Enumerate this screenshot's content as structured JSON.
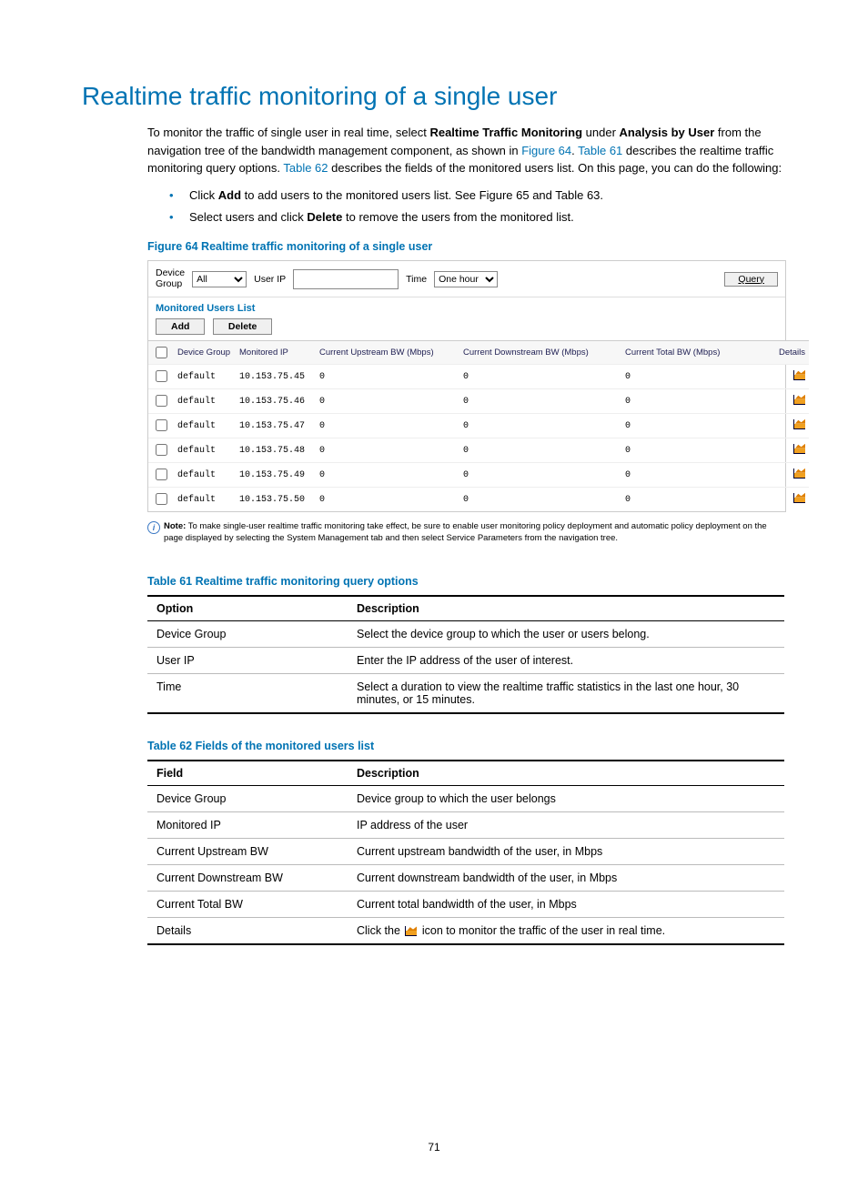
{
  "title": "Realtime traffic monitoring of a single user",
  "intro_parts": [
    {
      "t": "To monitor the traffic of single user in real time, select "
    },
    {
      "t": "Realtime Traffic Monitoring",
      "b": true
    },
    {
      "t": " under "
    },
    {
      "t": "Analysis by User",
      "b": true
    },
    {
      "t": " from the navigation tree of the bandwidth management component, as shown in "
    },
    {
      "t": "Figure 64",
      "link": true
    },
    {
      "t": ". "
    },
    {
      "t": "Table 61",
      "link": true
    },
    {
      "t": " describes the realtime traffic monitoring query options. "
    },
    {
      "t": "Table 62",
      "link": true
    },
    {
      "t": " describes the fields of the monitored users list. On this page, you can do the following:"
    }
  ],
  "bullets": [
    [
      {
        "t": "Click "
      },
      {
        "t": "Add",
        "b": true
      },
      {
        "t": " to add users to the monitored users list. See "
      },
      {
        "t": "Figure 65",
        "link": true
      },
      {
        "t": " and "
      },
      {
        "t": "Table 63",
        "link": true
      },
      {
        "t": "."
      }
    ],
    [
      {
        "t": "Select users and click "
      },
      {
        "t": "Delete",
        "b": true
      },
      {
        "t": " to remove the users from the monitored list."
      }
    ]
  ],
  "figure64_caption": "Figure 64  Realtime traffic monitoring of a single user",
  "ui": {
    "device_group_label": "Device\nGroup",
    "device_group_value": "All",
    "user_ip_label": "User IP",
    "user_ip_value": "",
    "time_label": "Time",
    "time_value": "One hour",
    "query_label": "Query",
    "section_title": "Monitored Users List",
    "add_label": "Add",
    "delete_label": "Delete",
    "headers": {
      "dg": "Device Group",
      "ip": "Monitored IP",
      "up": "Current Upstream BW (Mbps)",
      "dn": "Current Downstream BW (Mbps)",
      "tot": "Current Total BW (Mbps)",
      "det": "Details"
    },
    "rows": [
      {
        "dg": "default",
        "ip": "10.153.75.45",
        "up": "0",
        "dn": "0",
        "tot": "0"
      },
      {
        "dg": "default",
        "ip": "10.153.75.46",
        "up": "0",
        "dn": "0",
        "tot": "0"
      },
      {
        "dg": "default",
        "ip": "10.153.75.47",
        "up": "0",
        "dn": "0",
        "tot": "0"
      },
      {
        "dg": "default",
        "ip": "10.153.75.48",
        "up": "0",
        "dn": "0",
        "tot": "0"
      },
      {
        "dg": "default",
        "ip": "10.153.75.49",
        "up": "0",
        "dn": "0",
        "tot": "0"
      },
      {
        "dg": "default",
        "ip": "10.153.75.50",
        "up": "0",
        "dn": "0",
        "tot": "0"
      }
    ]
  },
  "note_label": "Note:",
  "note_text": "To make single-user realtime traffic monitoring take effect, be sure to enable user monitoring policy deployment and automatic policy deployment on the page displayed by selecting the System Management tab and then select Service Parameters from the navigation tree.",
  "table61_caption": "Table 61 Realtime traffic monitoring query options",
  "table61": {
    "head": {
      "c1": "Option",
      "c2": "Description"
    },
    "rows": [
      {
        "c1": "Device Group",
        "c2": "Select the device group to which the user or users belong."
      },
      {
        "c1": "User IP",
        "c2": "Enter the IP address of the user of interest."
      },
      {
        "c1": "Time",
        "c2": "Select a duration to view the realtime traffic statistics in the last one hour, 30 minutes, or 15 minutes."
      }
    ]
  },
  "table62_caption": "Table 62 Fields of the monitored users list",
  "table62": {
    "head": {
      "c1": "Field",
      "c2": "Description"
    },
    "rows": [
      {
        "c1": "Device Group",
        "c2": "Device group to which the user belongs"
      },
      {
        "c1": "Monitored IP",
        "c2": "IP address of the user"
      },
      {
        "c1": "Current Upstream BW",
        "c2": "Current upstream bandwidth of the user, in Mbps"
      },
      {
        "c1": "Current Downstream BW",
        "c2": "Current downstream bandwidth of the user, in Mbps"
      },
      {
        "c1": "Current Total BW",
        "c2": "Current total bandwidth of the user, in Mbps"
      },
      {
        "c1": "Details",
        "c2_pre": "Click the ",
        "c2_post": " icon to monitor the traffic of the user in real time."
      }
    ]
  },
  "page_number": "71"
}
